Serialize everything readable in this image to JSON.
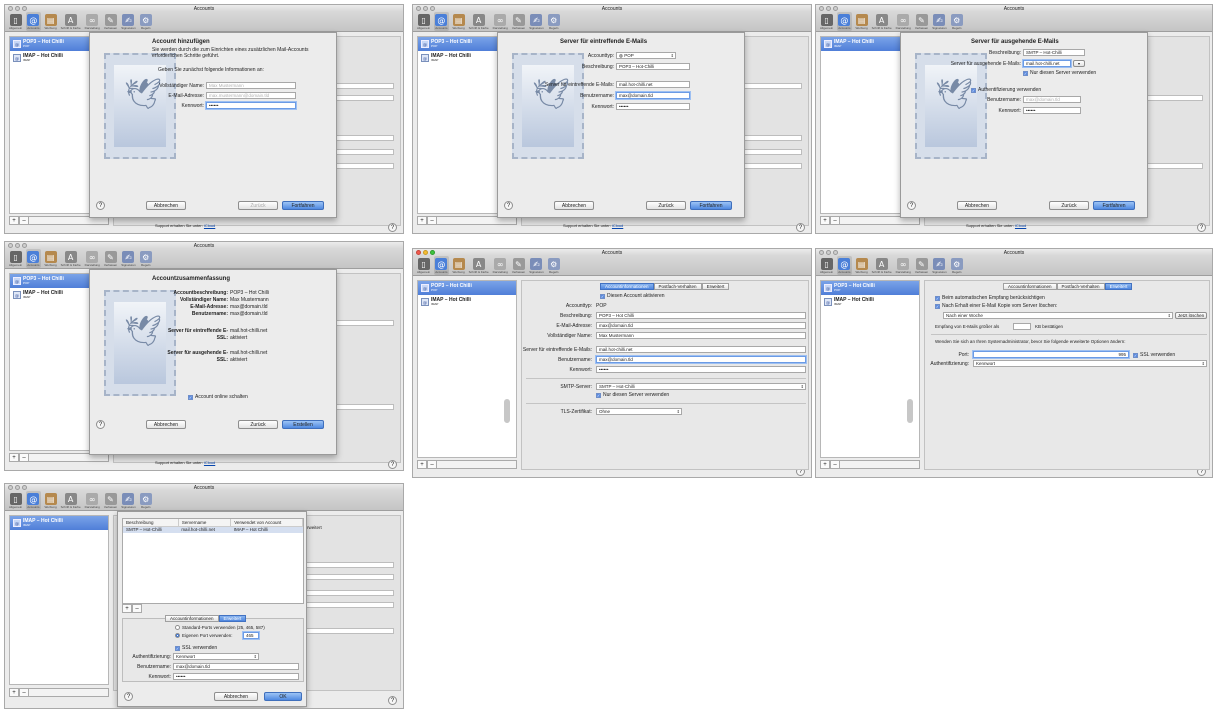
{
  "window_title": "Accounts",
  "toolbar": [
    "Allgemein",
    "Accounts",
    "Werbung",
    "Schrift & Farbe",
    "Darstellung",
    "Verfassen",
    "Signaturen",
    "Regeln"
  ],
  "accounts": {
    "pop": {
      "name": "POP3 – Hot Chilli",
      "type": "POP"
    },
    "imap": {
      "name": "IMAP – Hot Chilli",
      "type": "IMAP"
    }
  },
  "support": {
    "text": "Support erhalten Sie unter:",
    "link": "iCloud"
  },
  "help": "?",
  "plus": "+",
  "minus": "–",
  "buttons": {
    "cancel": "Abbrechen",
    "back": "Zurück",
    "next": "Fortfahren",
    "create": "Erstellen",
    "ok": "OK"
  },
  "step1": {
    "title": "Account hinzufügen",
    "intro": "Sie werden durch die zum Einrichten eines zusätzlichen Mail-Accounts erforderlichen Schritte geführt.",
    "prompt": "Geben Sie zunächst folgende Informationen an:",
    "name_label": "Vollständiger Name:",
    "name_ph": "Max Mustermann",
    "email_label": "E-Mail-Adresse:",
    "email_ph": "max.mustermann@domain.tld",
    "pw_label": "Kennwort:",
    "pw": "••••••"
  },
  "step2": {
    "title": "Server für eintreffende E-Mails",
    "type_label": "Accounttyp:",
    "type": "POP",
    "desc_label": "Beschreibung:",
    "desc": "POP3 – Hot-Chilli",
    "server_label": "Server für eintreffende E-Mails:",
    "server": "mail.hot-chilli.net",
    "user_label": "Benutzername:",
    "user": "max@domain.tld",
    "pw_label": "Kennwort:",
    "pw": "••••••"
  },
  "step3": {
    "title": "Server für ausgehende E-Mails",
    "desc_label": "Beschreibung:",
    "desc": "SMTP – Hot-Chilli",
    "server_label": "Server für ausgehende E-Mails:",
    "server": "mail.hot-chilli.net",
    "only_server": "Nur diesen Server verwenden",
    "auth": "Authentifizierung verwenden",
    "user_label": "Benutzername:",
    "user_ph": "max@domain.tld",
    "pw_label": "Kennwort:",
    "pw": "••••••"
  },
  "step4": {
    "title": "Accountzusammenfassung",
    "rows": [
      {
        "label": "Accountbeschreibung:",
        "value": "POP3 – Hot Chilli"
      },
      {
        "label": "Vollständiger Name:",
        "value": "Max Mustermann"
      },
      {
        "label": "E-Mail-Adresse:",
        "value": "max@domain.tld"
      },
      {
        "label": "Benutzername:",
        "value": "max@domain.tld"
      }
    ],
    "in_rows": [
      {
        "label": "Server für eintreffende E-",
        "value": "mail.hot-chilli.net"
      },
      {
        "label": "SSL:",
        "value": "aktiviert"
      }
    ],
    "out_rows": [
      {
        "label": "Server für ausgehende E-",
        "value": "mail.hot-chilli.net"
      },
      {
        "label": "SSL:",
        "value": "aktiviert"
      }
    ],
    "online": "Account online schalten"
  },
  "step5": {
    "tabs": [
      "Accountinformationen",
      "Postfach-Verhalten",
      "Erweitert"
    ],
    "enable": "Diesen Account aktivieren",
    "type_label": "Accounttyp:",
    "type": "POP",
    "desc_label": "Beschreibung:",
    "desc": "POP3 – Hot Chilli",
    "email_label": "E-Mail-Adresse:",
    "email": "max@domain.tld",
    "name_label": "Vollständiger Name:",
    "name": "Max Mustermann",
    "server_label": "Server für eintreffende E-Mails:",
    "server": "mail.hot-chilli.net",
    "user_label": "Benutzername:",
    "user": "max@domain.tld",
    "pw_label": "Kennwort:",
    "pw": "••••••",
    "smtp_label": "SMTP-Server:",
    "smtp": "SMTP – Hot-Chilli",
    "only_server": "Nur diesen Server verwenden",
    "tls_label": "TLS-Zertifikat:",
    "tls": "Ohne"
  },
  "step6": {
    "tabs": [
      "Accountinformationen",
      "Postfach-Verhalten",
      "Erweitert"
    ],
    "c1": "Beim automatischen Empfang berücksichtigen",
    "c2": "Nach Erhalt einer E-Mail Kopie vom Server löschen:",
    "after": "Nach einer Woche",
    "delete_now": "Jetzt löschen",
    "size_label": "Empfang von E-Mails größer als",
    "size_unit": "KB bestätigen",
    "note": "Wenden Sie sich an Ihren Systemadministrator, bevor Sie folgende erweiterte Optionen ändern:",
    "port_label": "Port:",
    "port": "995",
    "ssl": "SSL verwenden",
    "auth_label": "Authentifizierung:",
    "auth": "Kennwort"
  },
  "step7": {
    "cols": [
      "Beschreibung",
      "Servername",
      "Verwendet von Account"
    ],
    "row": [
      "SMTP – Hot-Chilli",
      "mail.hot-chilli.net",
      "IMAP – Hot Chilli"
    ],
    "tabs": [
      "Accountinformationen",
      "Erweitert"
    ],
    "std_ports": "Standard-Ports verwenden (25, 465, 587)",
    "own_port": "Eigenen Port verwenden:",
    "port": "465",
    "ssl": "SSL verwenden",
    "auth_label": "Authentifizierung:",
    "auth": "Kennwort",
    "user_label": "Benutzername:",
    "user": "max@domain.tld",
    "pw_label": "Kennwort:",
    "pw": "••••••",
    "behind_tab": "Erweitert"
  }
}
